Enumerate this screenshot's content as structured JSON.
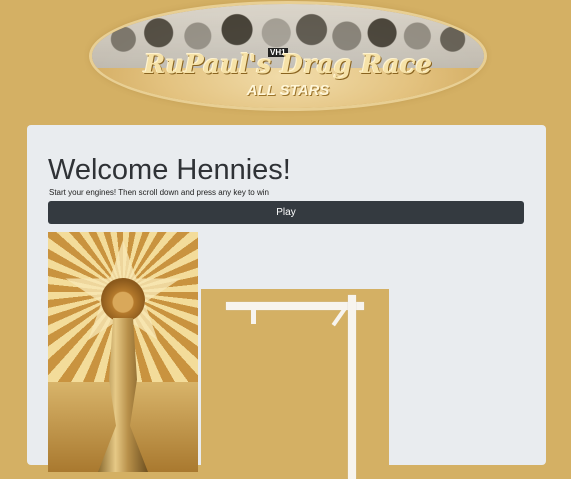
{
  "header": {
    "logo_network": "VH1",
    "logo_title": "RuPaul's Drag Race",
    "logo_subtitle": "ALL STARS"
  },
  "main": {
    "title": "Welcome Hennies!",
    "subtitle": "Start your engines! Then scroll down and press any key to win",
    "play_label": "Play"
  },
  "images": {
    "poster": "rupaul-gold-poster",
    "gallows": "hangman-gallows"
  },
  "colors": {
    "page_background": "#d4b064",
    "panel_background": "#e9ecef",
    "button_background": "#343a40",
    "button_text": "#ffffff",
    "gallows": "#f7f4ee"
  }
}
